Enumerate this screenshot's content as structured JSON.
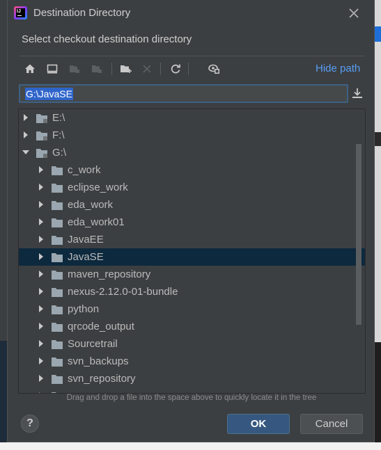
{
  "window": {
    "title": "Destination Directory",
    "app_icon_text": "IJ"
  },
  "subtitle": "Select checkout destination directory",
  "toolbar": {
    "buttons": [
      {
        "name": "home-icon",
        "enabled": true
      },
      {
        "name": "desktop-icon",
        "enabled": true
      },
      {
        "name": "project-icon",
        "enabled": false
      },
      {
        "name": "module-icon",
        "enabled": false
      },
      {
        "name": "new-folder-icon",
        "enabled": true
      },
      {
        "name": "delete-icon",
        "enabled": false
      },
      {
        "name": "refresh-icon",
        "enabled": true
      },
      {
        "name": "show-hidden-icon",
        "enabled": true
      }
    ],
    "hide_path_label": "Hide path"
  },
  "path_field": {
    "value": "G:\\JavaSE"
  },
  "tree": {
    "rows": [
      {
        "label": "E:\\",
        "level": 0,
        "expanded": false,
        "drive": true,
        "selected": false
      },
      {
        "label": "F:\\",
        "level": 0,
        "expanded": false,
        "drive": true,
        "selected": false
      },
      {
        "label": "G:\\",
        "level": 0,
        "expanded": true,
        "drive": true,
        "selected": false
      },
      {
        "label": "c_work",
        "level": 1,
        "expanded": false,
        "drive": false,
        "selected": false
      },
      {
        "label": "eclipse_work",
        "level": 1,
        "expanded": false,
        "drive": false,
        "selected": false
      },
      {
        "label": "eda_work",
        "level": 1,
        "expanded": false,
        "drive": false,
        "selected": false
      },
      {
        "label": "eda_work01",
        "level": 1,
        "expanded": false,
        "drive": false,
        "selected": false
      },
      {
        "label": "JavaEE",
        "level": 1,
        "expanded": false,
        "drive": false,
        "selected": false
      },
      {
        "label": "JavaSE",
        "level": 1,
        "expanded": false,
        "drive": false,
        "selected": true
      },
      {
        "label": "maven_repository",
        "level": 1,
        "expanded": false,
        "drive": false,
        "selected": false
      },
      {
        "label": "nexus-2.12.0-01-bundle",
        "level": 1,
        "expanded": false,
        "drive": false,
        "selected": false
      },
      {
        "label": "python",
        "level": 1,
        "expanded": false,
        "drive": false,
        "selected": false
      },
      {
        "label": "qrcode_output",
        "level": 1,
        "expanded": false,
        "drive": false,
        "selected": false
      },
      {
        "label": "Sourcetrail",
        "level": 1,
        "expanded": false,
        "drive": false,
        "selected": false
      },
      {
        "label": "svn_backups",
        "level": 1,
        "expanded": false,
        "drive": false,
        "selected": false
      },
      {
        "label": "svn_repository",
        "level": 1,
        "expanded": false,
        "drive": false,
        "selected": false
      },
      {
        "label": "",
        "level": 1,
        "expanded": false,
        "drive": false,
        "selected": false
      }
    ]
  },
  "hint": "Drag and drop a file into the space above to quickly locate it in the tree",
  "buttons": {
    "help": "?",
    "ok": "OK",
    "cancel": "Cancel"
  },
  "colors": {
    "dialog_bg": "#3c3f41",
    "selection_bg": "#0d293e",
    "link": "#589df6",
    "primary_button": "#365880"
  }
}
